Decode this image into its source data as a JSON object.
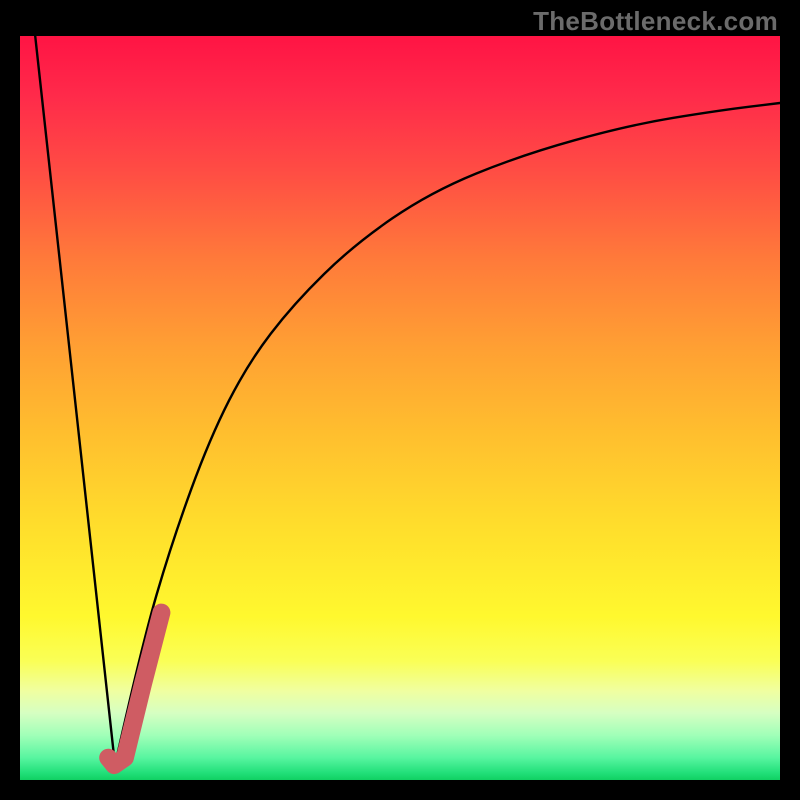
{
  "brand": {
    "label": "TheBottleneck.com"
  },
  "chart_data": {
    "type": "line",
    "title": "",
    "xlabel": "",
    "ylabel": "",
    "xlim": [
      0,
      100
    ],
    "ylim": [
      0,
      100
    ],
    "series": [
      {
        "name": "left-descent",
        "x": [
          2,
          12.5
        ],
        "values": [
          100,
          2
        ]
      },
      {
        "name": "right-rise",
        "x": [
          12.5,
          16,
          20,
          25,
          30,
          36,
          44,
          54,
          66,
          80,
          92,
          100
        ],
        "values": [
          2,
          18,
          32,
          46,
          56,
          64,
          72,
          79,
          84,
          88,
          90,
          91
        ]
      },
      {
        "name": "hook-overlay",
        "x": [
          11.6,
          12.4,
          13.8,
          16.2,
          18.6
        ],
        "values": [
          3.0,
          2.0,
          3.0,
          13.0,
          22.5
        ]
      }
    ],
    "gradient_stops": [
      {
        "pos": 0,
        "color": "#ff1444"
      },
      {
        "pos": 18,
        "color": "#ff4c44"
      },
      {
        "pos": 42,
        "color": "#ffa033"
      },
      {
        "pos": 66,
        "color": "#ffde2c"
      },
      {
        "pos": 84,
        "color": "#faff56"
      },
      {
        "pos": 94,
        "color": "#a0ffb8"
      },
      {
        "pos": 100,
        "color": "#10d062"
      }
    ],
    "hook_color": "#cf5c63"
  }
}
